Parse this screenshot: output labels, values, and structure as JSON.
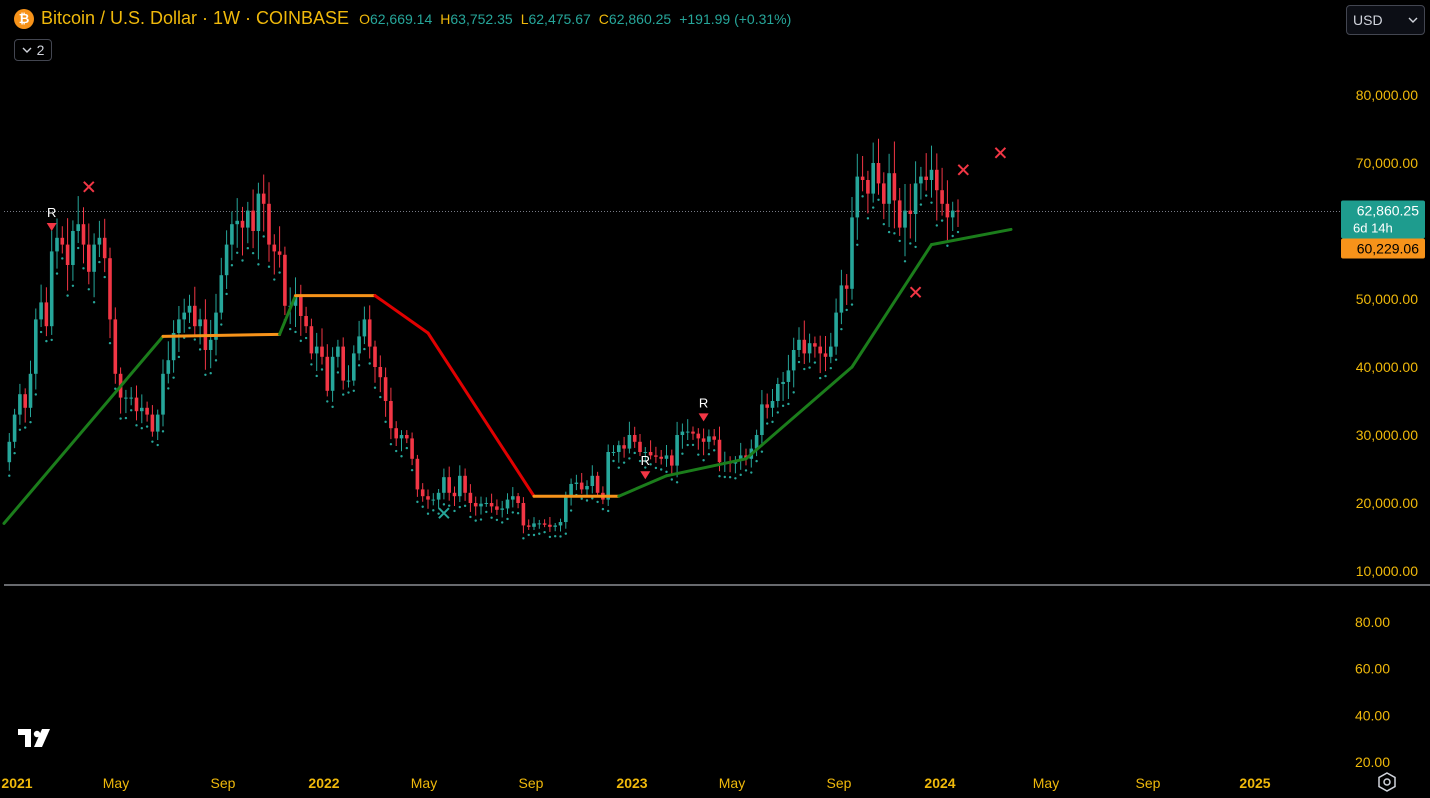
{
  "header": {
    "coin_icon_letter": "₿",
    "symbol": "Bitcoin / U.S. Dollar · 1W · COINBASE",
    "open_key": "O",
    "open": "62,669.14",
    "high_key": "H",
    "high": "63,752.35",
    "low_key": "L",
    "low": "62,475.67",
    "close_key": "C",
    "close": "62,860.25",
    "change": "+191.99 (+0.31%)",
    "indicator_count": "2"
  },
  "currency_select": {
    "value": "USD"
  },
  "price_axis": {
    "labels": [
      "80,000.00",
      "70,000.00",
      "50,000.00",
      "40,000.00",
      "30,000.00",
      "20,000.00",
      "10,000.00"
    ],
    "values": [
      80000,
      70000,
      50000,
      40000,
      30000,
      20000,
      10000
    ],
    "last_price_label": "62,860.25",
    "countdown": "6d 14h",
    "stop_label": "60,229.06"
  },
  "oscillator_axis": {
    "labels": [
      "80.00",
      "60.00",
      "40.00",
      "20.00"
    ],
    "values": [
      80,
      60,
      40,
      20
    ]
  },
  "time_axis": {
    "labels": [
      "2021",
      "May",
      "Sep",
      "2022",
      "May",
      "Sep",
      "2023",
      "May",
      "Sep",
      "2024",
      "May",
      "Sep",
      "2025"
    ],
    "bold": [
      true,
      false,
      false,
      true,
      false,
      false,
      true,
      false,
      false,
      true,
      false,
      false,
      true
    ]
  },
  "colors": {
    "up": "#26a69a",
    "down": "#f23645",
    "bull_line": "#1b7d1b",
    "bear_line": "#e00000",
    "flat_line": "#f7931a",
    "axis_text": "#f0b90b",
    "price_badge": "#1e9c8e",
    "stop_badge": "#f7931a"
  },
  "chart_data": {
    "type": "candlestick",
    "title": "Bitcoin / U.S. Dollar · 1W · COINBASE",
    "ylim": [
      10000,
      80000
    ],
    "x_range": [
      "2021-01",
      "2025-01"
    ],
    "last_close": 62860.25,
    "stop_level": 60229.06,
    "weekly_close": [
      26000,
      29000,
      33000,
      36000,
      34000,
      39000,
      47000,
      49500,
      46000,
      57000,
      59000,
      58000,
      55000,
      60000,
      61000,
      58000,
      54000,
      58000,
      59000,
      56000,
      47000,
      39000,
      35500,
      35500,
      35500,
      33500,
      34000,
      33000,
      30500,
      33000,
      39000,
      41000,
      45000,
      47000,
      48000,
      49000,
      46000,
      47000,
      42500,
      44000,
      48000,
      53500,
      58000,
      61000,
      61500,
      60500,
      63000,
      60000,
      65500,
      64000,
      58000,
      57000,
      56500,
      49000,
      49000,
      50500,
      47500,
      46000,
      42000,
      43000,
      41500,
      36500,
      41500,
      43000,
      38000,
      38000,
      42000,
      44500,
      47000,
      43000,
      40000,
      38500,
      35000,
      31000,
      29500,
      30000,
      29500,
      26500,
      22000,
      21000,
      20500,
      20500,
      21500,
      23800,
      21500,
      21000,
      24000,
      21500,
      20000,
      19500,
      19900,
      20000,
      19500,
      19000,
      19200,
      20500,
      21000,
      20000,
      16700,
      16500,
      17000,
      17000,
      16800,
      16500,
      16700,
      17200,
      21000,
      22800,
      23000,
      22000,
      22500,
      24000,
      21500,
      20500,
      27500,
      27500,
      28500,
      28000,
      30000,
      29000,
      27500,
      27500,
      27000,
      26800,
      26500,
      27000,
      25500,
      30000,
      30500,
      30500,
      30200,
      29500,
      29000,
      29800,
      29300,
      26000,
      26000,
      25800,
      26200,
      27000,
      26500,
      28000,
      30000,
      34500,
      34000,
      35000,
      37500,
      37800,
      39500,
      42500,
      44000,
      42000,
      43500,
      43000,
      42000,
      41500,
      43000,
      48000,
      52000,
      51500,
      62000,
      68000,
      67500,
      65500,
      70000,
      67000,
      64000,
      68500,
      64500,
      60500,
      63000,
      62500,
      67000,
      68000,
      67500,
      69000,
      66000,
      64000,
      62000,
      63000,
      62860
    ],
    "trailing_line": [
      {
        "week": 0,
        "value": 17000
      },
      {
        "week": 30,
        "value": 44500
      },
      {
        "week": 52,
        "value": 44800
      },
      {
        "week": 55,
        "value": 50500
      },
      {
        "week": 70,
        "value": 50500
      },
      {
        "week": 80,
        "value": 45000
      },
      {
        "week": 100,
        "value": 21000
      },
      {
        "week": 116,
        "value": 21000
      },
      {
        "week": 125,
        "value": 24000
      },
      {
        "week": 140,
        "value": 26500
      },
      {
        "week": 160,
        "value": 40000
      },
      {
        "week": 175,
        "value": 58000
      },
      {
        "week": 190,
        "value": 60229
      }
    ],
    "signal_markers": [
      {
        "type": "R",
        "week": 9,
        "price": 60000
      },
      {
        "type": "x",
        "week": 16,
        "price": 66500
      },
      {
        "type": "x-green",
        "week": 83,
        "price": 18500
      },
      {
        "type": "R",
        "week": 121,
        "price": 23500
      },
      {
        "type": "R",
        "week": 132,
        "price": 32000
      },
      {
        "type": "x",
        "week": 172,
        "price": 51000
      },
      {
        "type": "x",
        "week": 181,
        "price": 69000
      },
      {
        "type": "x",
        "week": 188,
        "price": 71500
      }
    ]
  }
}
